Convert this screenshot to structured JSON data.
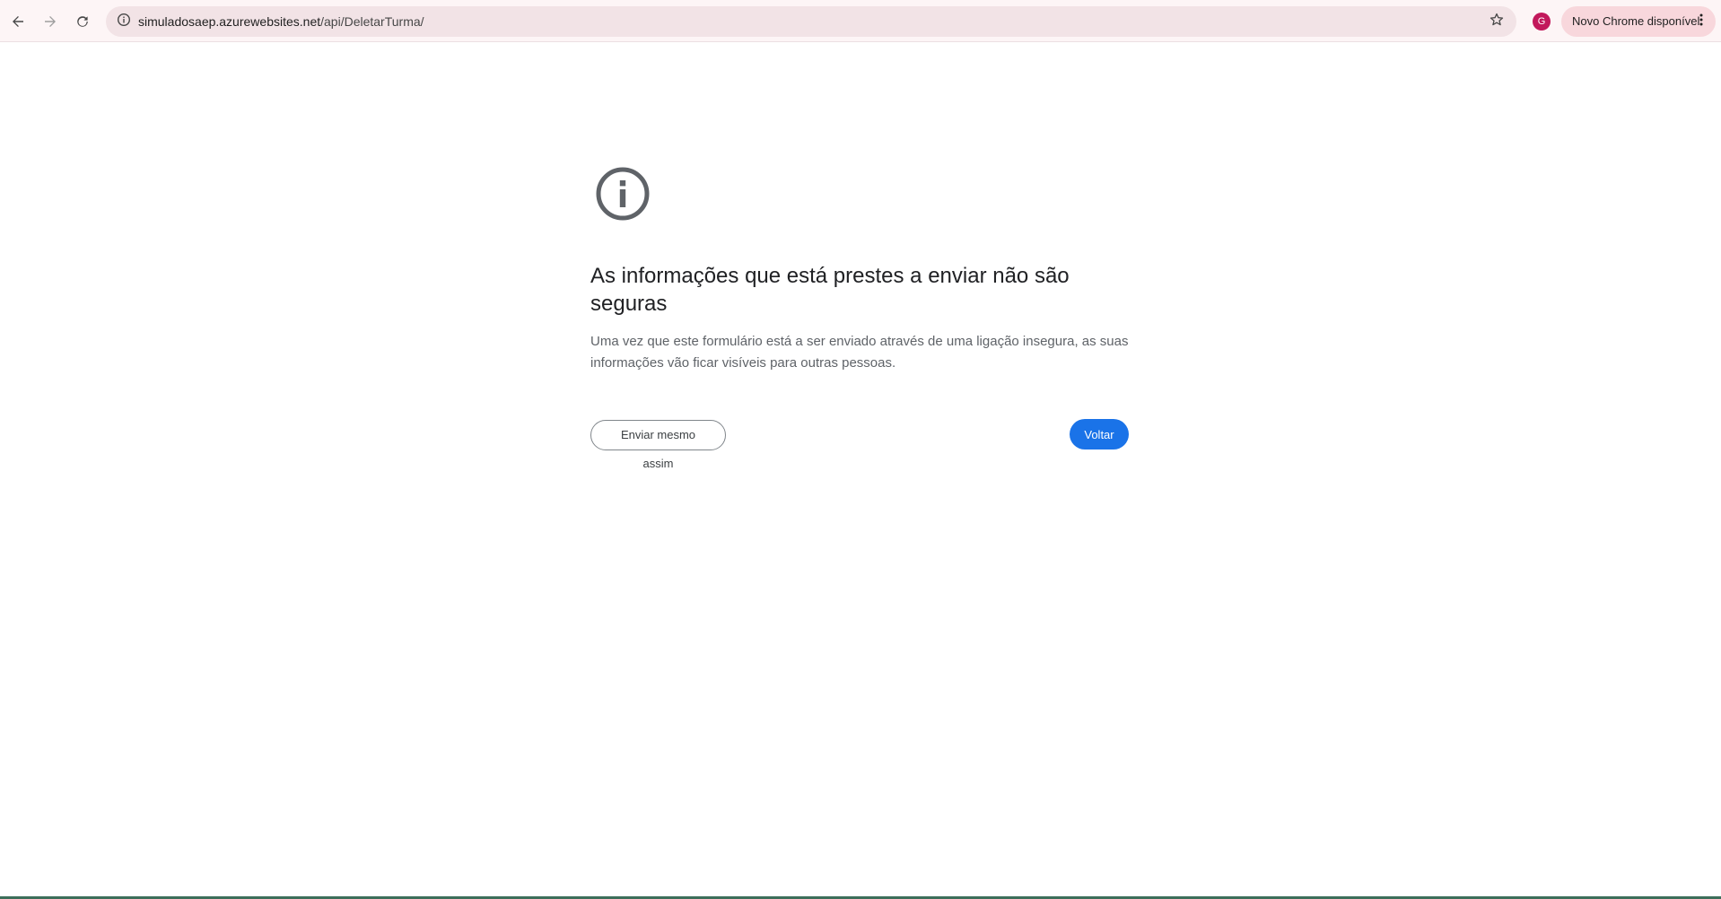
{
  "browser": {
    "url_host": "simuladosaep.azurewebsites.net",
    "url_path": "/api/DeletarTurma/",
    "avatar_letter": "G",
    "update_chip_label": "Novo Chrome disponível",
    "icons": {
      "back": "back-arrow-icon",
      "forward": "forward-arrow-icon",
      "reload": "reload-icon",
      "site_info": "info-circle-icon",
      "bookmark": "star-icon",
      "menu": "kebab-menu-icon"
    },
    "colors": {
      "toolbar_bg": "#fdf5f6",
      "omnibox_bg": "#f2e3e6",
      "chip_bg": "#f8d7dc",
      "avatar_bg": "#c2185b"
    }
  },
  "interstitial": {
    "icon": "info-icon",
    "title": "As informações que está prestes a enviar não são seguras",
    "description": "Uma vez que este formulário está a ser enviado através de uma ligação insegura, as suas informações vão ficar visíveis para outras pessoas.",
    "proceed_label": "Enviar mesmo assim",
    "back_label": "Voltar",
    "colors": {
      "primary": "#1a73e8",
      "icon": "#5f6368",
      "title": "#202124",
      "text": "#5f6368"
    }
  }
}
